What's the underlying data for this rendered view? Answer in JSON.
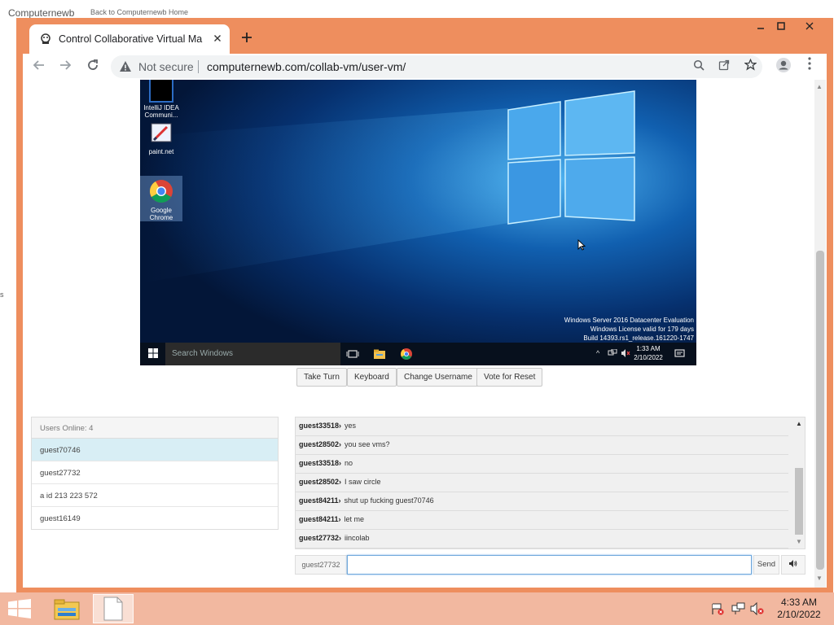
{
  "background_page": {
    "site_name": "Computernewb",
    "back_link": "Back to Computernewb Home",
    "fragment": "s"
  },
  "browser": {
    "tab": {
      "title": "Control Collaborative Virtual Ma"
    },
    "address_bar": {
      "security_label": "Not secure",
      "url": "computernewb.com/collab-vm/user-vm/"
    },
    "accent_color": "#ee8e5e"
  },
  "vm": {
    "desktop_icons": [
      {
        "label": "IntelliJ IDEA Communi..."
      },
      {
        "label": "paint.net"
      },
      {
        "label": "Google Chrome"
      }
    ],
    "watermark": {
      "line1": "Windows Server 2016 Datacenter Evaluation",
      "line2": "Windows License valid for 179 days",
      "line3": "Build 14393.rs1_release.161220-1747"
    },
    "taskbar": {
      "search_placeholder": "Search Windows",
      "time": "1:33 AM",
      "date": "2/10/2022"
    }
  },
  "controls": {
    "take_turn": "Take Turn",
    "keyboard": "Keyboard",
    "change_username": "Change Username",
    "vote_reset": "Vote for Reset"
  },
  "users": {
    "header": "Users Online: 4",
    "list": [
      {
        "name": "guest70746"
      },
      {
        "name": "guest27732"
      },
      {
        "name": "a id 213 223 572"
      },
      {
        "name": "guest16149"
      }
    ]
  },
  "chat": {
    "messages": [
      {
        "user": "guest33518",
        "sep": "›",
        "text": "yes"
      },
      {
        "user": "guest28502",
        "sep": "›",
        "text": "you see vms?"
      },
      {
        "user": "guest33518",
        "sep": "›",
        "text": "no"
      },
      {
        "user": "guest28502",
        "sep": "›",
        "text": "I saw circle"
      },
      {
        "user": "guest84211",
        "sep": "›",
        "text": "shut up fucking guest70746"
      },
      {
        "user": "guest84211",
        "sep": "›",
        "text": "let me"
      },
      {
        "user": "guest27732",
        "sep": "›",
        "text": "iincolab"
      }
    ],
    "current_username": "guest27732",
    "input_value": "",
    "send_label": "Send"
  },
  "host_taskbar": {
    "time": "4:33 AM",
    "date": "2/10/2022"
  }
}
